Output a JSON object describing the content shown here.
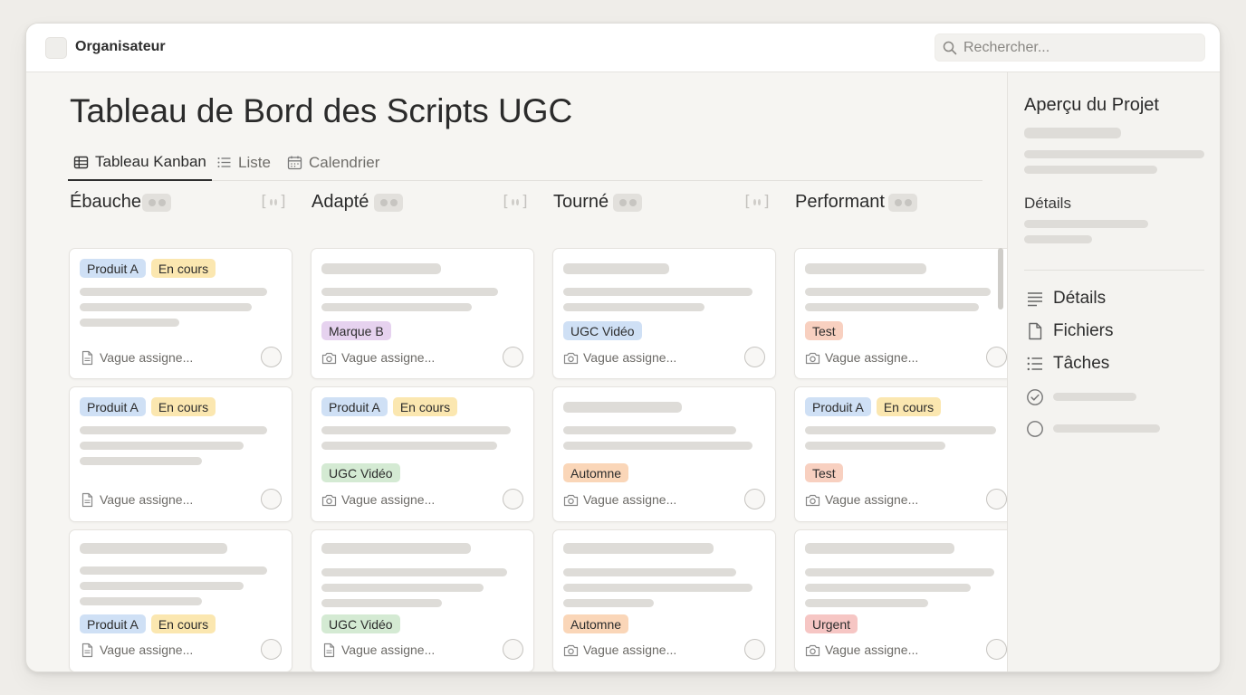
{
  "app": {
    "title": "Organisateur"
  },
  "search": {
    "placeholder": "Rechercher..."
  },
  "page": {
    "title": "Tableau de Bord des Scripts UGC"
  },
  "tabs": [
    {
      "label": "Tableau Kanban",
      "icon": "table-icon",
      "active": true
    },
    {
      "label": "Liste",
      "icon": "list-icon",
      "active": false
    },
    {
      "label": "Calendrier",
      "icon": "calendar-icon",
      "active": false
    }
  ],
  "columns": [
    {
      "title": "Ébauche",
      "cards": [
        {
          "tags": [
            {
              "label": "Produit A",
              "color": "blue"
            },
            {
              "label": "En cours",
              "color": "yellow"
            }
          ],
          "assignee": "Vague assigne...",
          "footer_icon": "document-icon"
        },
        {
          "tags": [
            {
              "label": "Produit A",
              "color": "blue"
            },
            {
              "label": "En cours",
              "color": "yellow"
            }
          ],
          "assignee": "Vague assigne...",
          "footer_icon": "document-icon"
        },
        {
          "tags": [
            {
              "label": "Produit A",
              "color": "blue"
            },
            {
              "label": "En cours",
              "color": "yellow"
            }
          ],
          "assignee": "Vague assigne...",
          "footer_icon": "document-icon"
        }
      ]
    },
    {
      "title": "Adapté",
      "cards": [
        {
          "tags": [
            {
              "label": "Marque B",
              "color": "purple"
            }
          ],
          "assignee": "Vague assigne...",
          "footer_icon": "camera-icon"
        },
        {
          "tags": [
            {
              "label": "Produit A",
              "color": "blue"
            },
            {
              "label": "En cours",
              "color": "yellow"
            }
          ],
          "tags2": [
            {
              "label": "UGC Vidéo",
              "color": "green"
            }
          ],
          "assignee": "Vague assigne...",
          "footer_icon": "camera-icon"
        },
        {
          "tags": [
            {
              "label": "UGC Vidéo",
              "color": "green"
            }
          ],
          "assignee": "Vague assigne...",
          "footer_icon": "document-icon"
        }
      ]
    },
    {
      "title": "Tourné",
      "cards": [
        {
          "tags": [
            {
              "label": "UGC Vidéo",
              "color": "blue"
            }
          ],
          "assignee": "Vague assigne...",
          "footer_icon": "camera-icon"
        },
        {
          "tags": [
            {
              "label": "Automne",
              "color": "orange"
            }
          ],
          "assignee": "Vague assigne...",
          "footer_icon": "camera-icon"
        },
        {
          "tags": [
            {
              "label": "Automne",
              "color": "orange"
            }
          ],
          "assignee": "Vague assigne...",
          "footer_icon": "camera-icon"
        }
      ]
    },
    {
      "title": "Performant",
      "cards": [
        {
          "tags": [
            {
              "label": "Test",
              "color": "salmon"
            }
          ],
          "assignee": "Vague assigne...",
          "footer_icon": "camera-icon"
        },
        {
          "tags": [
            {
              "label": "Produit A",
              "color": "blue"
            },
            {
              "label": "En cours",
              "color": "yellow"
            }
          ],
          "tags2": [
            {
              "label": "Test",
              "color": "salmon"
            }
          ],
          "assignee": "Vague assigne...",
          "footer_icon": "camera-icon"
        },
        {
          "tags": [
            {
              "label": "Urgent",
              "color": "red"
            }
          ],
          "assignee": "Vague assigne...",
          "footer_icon": "camera-icon"
        }
      ]
    }
  ],
  "sidebar": {
    "title": "Aperçu du Projet",
    "section_label": "Détails",
    "items": [
      {
        "label": "Détails",
        "icon": "lines-icon"
      },
      {
        "label": "Fichiers",
        "icon": "file-icon"
      },
      {
        "label": "Tâches",
        "icon": "checklist-icon"
      }
    ],
    "checklist": [
      {
        "icon": "check-circle-icon",
        "done": true
      },
      {
        "icon": "empty-circle-icon",
        "done": false
      }
    ]
  },
  "colors": {
    "background": "#efede9",
    "card": "#ffffff",
    "tag_blue": "#cfe0f5",
    "tag_yellow": "#fbe7b0",
    "tag_purple": "#e6d2ef",
    "tag_green": "#d4ead3",
    "tag_orange": "#fad6b8",
    "tag_salmon": "#f8d0c0",
    "tag_red": "#f6c6c4"
  }
}
